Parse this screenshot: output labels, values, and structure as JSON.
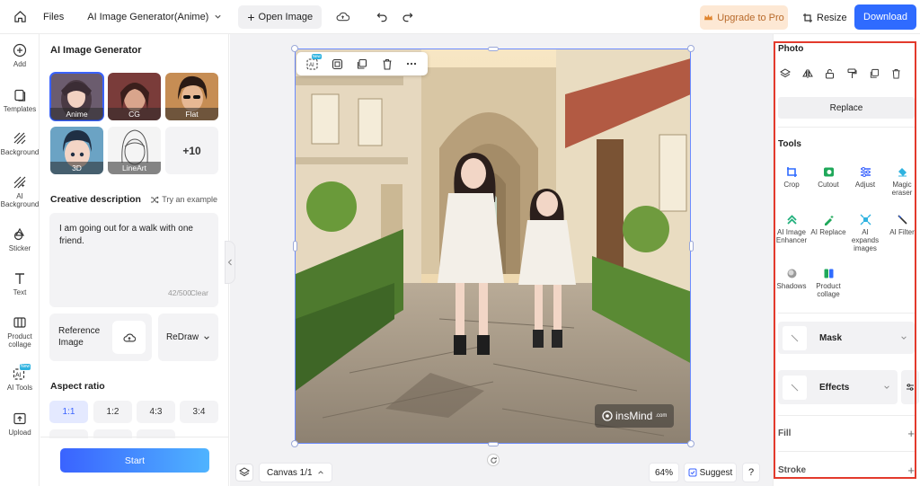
{
  "topbar": {
    "files": "Files",
    "doc_title": "AI Image Generator(Anime)",
    "open_image": "Open Image",
    "upgrade": "Upgrade to Pro",
    "resize": "Resize",
    "download": "Download"
  },
  "rail": [
    {
      "label": "Add",
      "icon": "plus-circle-icon"
    },
    {
      "label": "Templates",
      "icon": "templates-icon"
    },
    {
      "label": "Background",
      "icon": "background-icon"
    },
    {
      "label": "AI Background",
      "icon": "ai-background-icon"
    },
    {
      "label": "Sticker",
      "icon": "sticker-icon"
    },
    {
      "label": "Text",
      "icon": "text-icon"
    },
    {
      "label": "Product collage",
      "icon": "collage-icon"
    },
    {
      "label": "AI Tools",
      "icon": "ai-tools-icon",
      "badge": "New"
    },
    {
      "label": "Upload",
      "icon": "upload-icon"
    }
  ],
  "generator": {
    "title": "AI Image Generator",
    "styles": [
      {
        "label": "Anime",
        "selected": true,
        "color": "#6b5c6e"
      },
      {
        "label": "CG",
        "selected": false,
        "color": "#7a3c3a"
      },
      {
        "label": "Flat",
        "selected": false,
        "color": "#c68d54"
      },
      {
        "label": "3D",
        "selected": false,
        "color": "#6ba3c4"
      },
      {
        "label": "LineArt",
        "selected": false,
        "color": "#d8d8d8"
      }
    ],
    "more_styles": "+10",
    "creative_title": "Creative description",
    "try_example": "Try an example",
    "description": "I am going out for a walk with one friend.",
    "char_count": "42/500",
    "clear": "Clear",
    "reference_label": "Reference Image",
    "redraw": "ReDraw",
    "aspect_title": "Aspect ratio",
    "ratios": [
      {
        "label": "1:1",
        "selected": true
      },
      {
        "label": "1:2",
        "selected": false
      },
      {
        "label": "4:3",
        "selected": false
      },
      {
        "label": "3:4",
        "selected": false
      }
    ],
    "start": "Start"
  },
  "canvas": {
    "watermark_brand": "insMind",
    "watermark_suffix": ".com",
    "new_badge": "New",
    "canvas_label": "Canvas 1/1",
    "zoom": "64%",
    "suggest": "Suggest",
    "help": "?"
  },
  "right_panel": {
    "photo_title": "Photo",
    "replace": "Replace",
    "tools_title": "Tools",
    "tools": [
      {
        "label": "Crop",
        "icon": "crop-icon",
        "color": "#2f6bff"
      },
      {
        "label": "Cutout",
        "icon": "cutout-icon",
        "color": "#1fa85a"
      },
      {
        "label": "Adjust",
        "icon": "adjust-icon",
        "color": "#3a63ff"
      },
      {
        "label": "Magic eraser",
        "icon": "magic-eraser-icon",
        "color": "#2fb3e0"
      },
      {
        "label": "AI Image Enhancer",
        "icon": "enhancer-icon",
        "color": "#22b07d"
      },
      {
        "label": "AI Replace",
        "icon": "ai-replace-icon",
        "color": "#1fa85a"
      },
      {
        "label": "AI expands images",
        "icon": "expand-icon",
        "color": "#2fb3e0"
      },
      {
        "label": "AI Filter",
        "icon": "ai-filter-icon",
        "color": "#2f6bff"
      },
      {
        "label": "Shadows",
        "icon": "shadows-icon",
        "color": "#888888"
      },
      {
        "label": "Product collage",
        "icon": "product-collage-icon",
        "color": "#1fa85a"
      }
    ],
    "mask": "Mask",
    "effects": "Effects",
    "fill": "Fill",
    "stroke": "Stroke"
  }
}
